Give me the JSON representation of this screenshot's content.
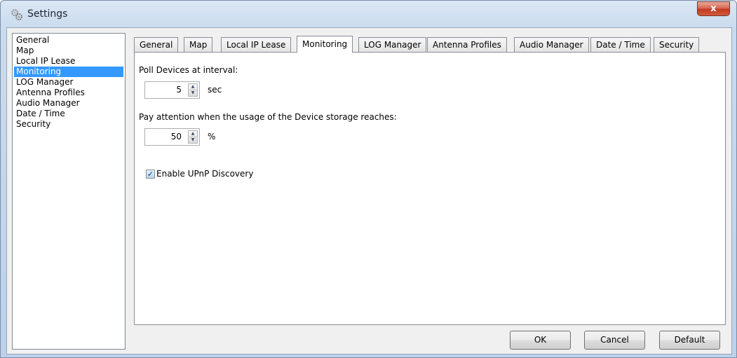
{
  "window": {
    "title": "Settings",
    "close_glyph": "x"
  },
  "sidebar": {
    "items": [
      {
        "label": "General"
      },
      {
        "label": "Map"
      },
      {
        "label": "Local IP Lease"
      },
      {
        "label": "Monitoring",
        "selected": true
      },
      {
        "label": "LOG Manager"
      },
      {
        "label": "Antenna Profiles"
      },
      {
        "label": "Audio Manager"
      },
      {
        "label": "Date / Time"
      },
      {
        "label": "Security"
      }
    ]
  },
  "tabs": [
    {
      "label": "General"
    },
    {
      "label": "Map"
    },
    {
      "label": "Local IP Lease"
    },
    {
      "label": "Monitoring",
      "active": true
    },
    {
      "label": "LOG Manager"
    },
    {
      "label": "Antenna Profiles"
    },
    {
      "label": "Audio Manager"
    },
    {
      "label": "Date / Time"
    },
    {
      "label": "Security"
    }
  ],
  "monitoring": {
    "poll_label": "Poll Devices at interval:",
    "poll_value": "5",
    "poll_unit": "sec",
    "storage_label": "Pay attention when the usage of the Device storage reaches:",
    "storage_value": "50",
    "storage_unit": "%",
    "upnp_label": "Enable UPnP Discovery",
    "upnp_checked": true,
    "check_glyph": "✓"
  },
  "buttons": {
    "ok": "OK",
    "cancel": "Cancel",
    "default": "Default"
  },
  "icons": {
    "title": "gears-icon",
    "spin_up": "▲",
    "spin_down": "▼"
  },
  "colors": {
    "selection": "#3399ff",
    "close_button": "#c0391f"
  }
}
